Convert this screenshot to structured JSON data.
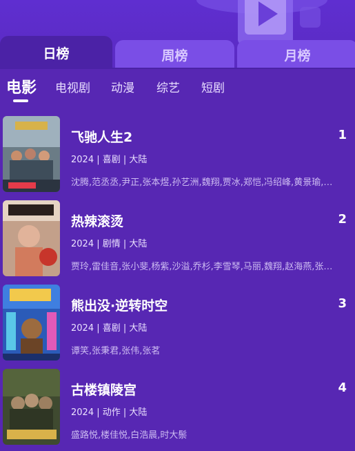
{
  "period_tabs": [
    {
      "label": "日榜",
      "active": true
    },
    {
      "label": "周榜",
      "active": false
    },
    {
      "label": "月榜",
      "active": false
    }
  ],
  "categories": [
    {
      "label": "电影",
      "active": true
    },
    {
      "label": "电视剧",
      "active": false
    },
    {
      "label": "动漫",
      "active": false
    },
    {
      "label": "综艺",
      "active": false
    },
    {
      "label": "短剧",
      "active": false
    }
  ],
  "movies": [
    {
      "rank": "1",
      "title": "飞驰人生2",
      "meta": "2024 | 喜剧 | 大陆",
      "cast": "沈腾,范丞丞,尹正,张本煜,孙艺洲,魏翔,贾冰,郑恺,冯绍峰,黄景瑜,…",
      "poster_icon": "movie-poster"
    },
    {
      "rank": "2",
      "title": "热辣滚烫",
      "meta": "2024 | 剧情 | 大陆",
      "cast": "贾玲,雷佳音,张小斐,杨紫,沙溢,乔杉,李雪琴,马丽,魏翔,赵海燕,张…",
      "poster_icon": "movie-poster"
    },
    {
      "rank": "3",
      "title": "熊出没·逆转时空",
      "meta": "2024 | 喜剧 | 大陆",
      "cast": "谭笑,张秉君,张伟,张茗",
      "poster_icon": "movie-poster"
    },
    {
      "rank": "4",
      "title": "古楼镇陵宫",
      "meta": "2024 | 动作 | 大陆",
      "cast": "盛路悦,楼佳悦,白浩晨,时大鬃",
      "poster_icon": "movie-poster"
    }
  ],
  "colors": {
    "background": "#5727b3",
    "active_tab": "#4b22a6",
    "inactive_tab": "#7a4ee6"
  }
}
